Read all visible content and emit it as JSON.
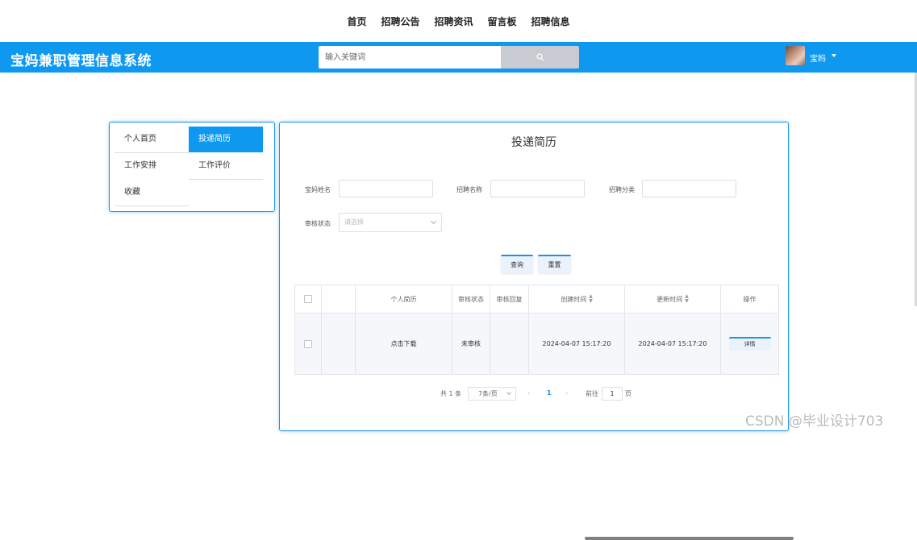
{
  "top_nav": {
    "items": [
      "首页",
      "招聘公告",
      "招聘资讯",
      "留言板",
      "招聘信息"
    ]
  },
  "header": {
    "brand": "宝妈兼职管理信息系统",
    "search_placeholder": "输入关键词",
    "username": "宝妈",
    "accent_color": "#0f98f0"
  },
  "sidebar": {
    "items": [
      {
        "label": "个人首页",
        "active": false
      },
      {
        "label": "投递简历",
        "active": true
      },
      {
        "label": "工作安排",
        "active": false
      },
      {
        "label": "工作评价",
        "active": false
      },
      {
        "label": "收藏",
        "active": false
      }
    ]
  },
  "main": {
    "title": "投递简历",
    "filters": {
      "name_label": "宝妈姓名",
      "recruit_name_label": "招聘名称",
      "category_label": "招聘分类",
      "status_label": "审核状态",
      "status_placeholder": "请选择"
    },
    "buttons": {
      "query": "查询",
      "reset": "重置"
    },
    "table": {
      "columns": [
        "",
        "",
        "个人简历",
        "审核状态",
        "审核回复",
        "创建时间",
        "更新时间",
        "操作"
      ],
      "rows": [
        {
          "resume": "点击下载",
          "status": "未审核",
          "reply": "",
          "created": "2024-04-07 15:17:20",
          "updated": "2024-04-07 15:17:20",
          "action": "详情"
        }
      ]
    },
    "pagination": {
      "total": "共 1 条",
      "page_size": "7条/页",
      "current_page": "1",
      "goto_label": "前往",
      "goto_value": "1",
      "page_suffix": "页"
    }
  },
  "watermark": "CSDN @毕业设计703"
}
